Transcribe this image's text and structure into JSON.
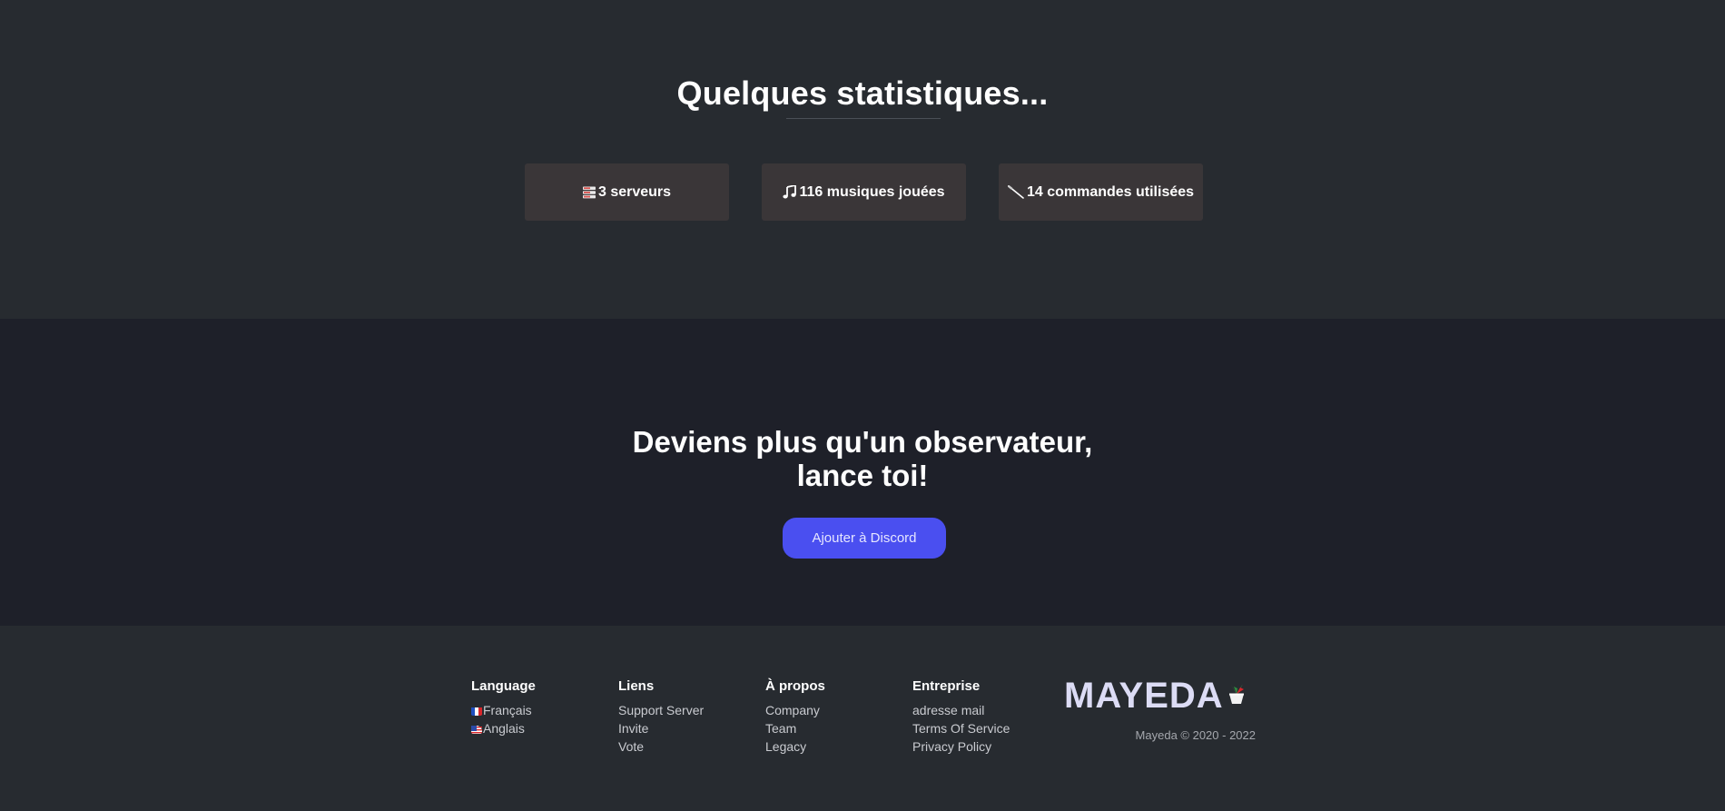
{
  "stats": {
    "title": "Quelques statistiques...",
    "cards": [
      {
        "icon": "server-icon",
        "text": "3 serveurs"
      },
      {
        "icon": "music-note-icon",
        "text": "116 musiques jouées"
      },
      {
        "icon": "wand-icon",
        "text": "14 commandes utilisées"
      }
    ]
  },
  "cta": {
    "title_line1": "Deviens plus qu'un observateur,",
    "title_line2": "lance toi!",
    "button_label": "Ajouter à Discord"
  },
  "footer": {
    "language": {
      "heading": "Language",
      "items": [
        "Français",
        "Anglais"
      ]
    },
    "links": {
      "heading": "Liens",
      "items": [
        "Support Server",
        "Invite",
        "Vote"
      ]
    },
    "about": {
      "heading": "À propos",
      "items": [
        "Company",
        "Team",
        "Legacy"
      ]
    },
    "company": {
      "heading": "Entreprise",
      "items": [
        "adresse mail",
        "Terms Of Service",
        "Privacy Policy"
      ]
    },
    "logo_text": "MAYEDA",
    "copyright": "Mayeda © 2020 - 2022"
  },
  "colors": {
    "page_bg": "#272b30",
    "cta_bg": "#1e2029",
    "card_bg": "#3a3638",
    "button_bg": "#4a4ff0"
  }
}
